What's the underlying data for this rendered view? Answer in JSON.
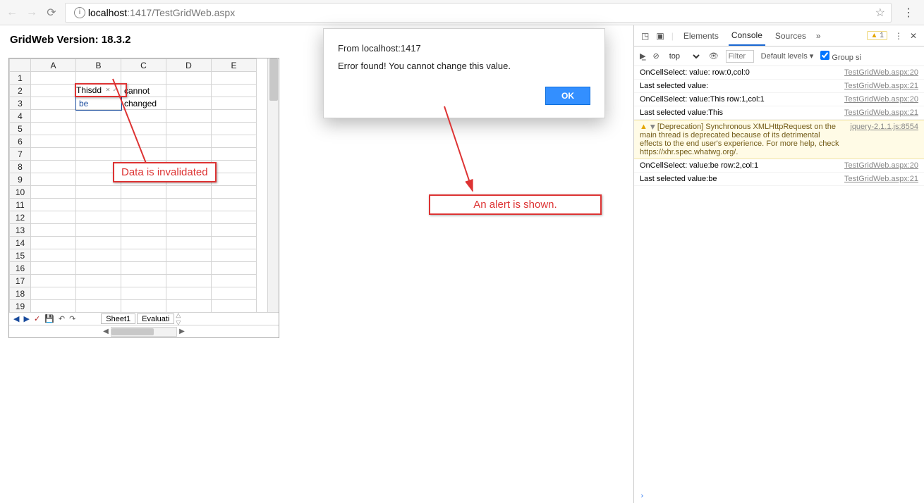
{
  "browser": {
    "url_host": "localhost",
    "url_port": ":1417",
    "url_path": "/TestGridWeb.aspx"
  },
  "page": {
    "version_label": "GridWeb Version:",
    "version_value": "18.3.2"
  },
  "grid": {
    "columns": [
      "A",
      "B",
      "C",
      "D",
      "E"
    ],
    "row_headers": [
      "1",
      "2",
      "3",
      "4",
      "5",
      "6",
      "7",
      "8",
      "9",
      "10",
      "11",
      "12",
      "13",
      "14",
      "15",
      "16",
      "17",
      "18",
      "19"
    ],
    "cells": {
      "B2_edit_value": "Thisdd",
      "C2": "cannot",
      "B3": "be",
      "C3": "changed"
    },
    "sheet_tabs": [
      "Sheet1",
      "Evaluati"
    ]
  },
  "annotations": {
    "data_invalidated": "Data is invalidated",
    "alert_shown": "An alert is shown."
  },
  "alert": {
    "title": "From localhost:1417",
    "body": "Error found! You cannot change this value.",
    "ok": "OK"
  },
  "devtools": {
    "tabs": [
      "Elements",
      "Console",
      "Sources"
    ],
    "active_tab": "Console",
    "warn_count": "1",
    "context": "top",
    "filter_placeholder": "Filter",
    "levels_label": "Default levels",
    "group_label": "Group si",
    "logs": [
      {
        "msg": "OnCellSelect: value: row:0,col:0",
        "src": "TestGridWeb.aspx:20"
      },
      {
        "msg": "Last selected value:",
        "src": "TestGridWeb.aspx:21"
      },
      {
        "msg": "OnCellSelect: value:This row:1,col:1",
        "src": "TestGridWeb.aspx:20"
      },
      {
        "msg": "Last selected value:This",
        "src": "TestGridWeb.aspx:21"
      },
      {
        "warn": true,
        "msg": "[Deprecation] Synchronous XMLHttpRequest on the main thread is deprecated because of its detrimental effects to the end user's experience. For more help, check https://xhr.spec.whatwg.org/.",
        "src": "jquery-2.1.1.js:8554"
      },
      {
        "msg": "OnCellSelect: value:be row:2,col:1",
        "src": "TestGridWeb.aspx:20"
      },
      {
        "msg": "Last selected value:be",
        "src": "TestGridWeb.aspx:21"
      }
    ]
  }
}
